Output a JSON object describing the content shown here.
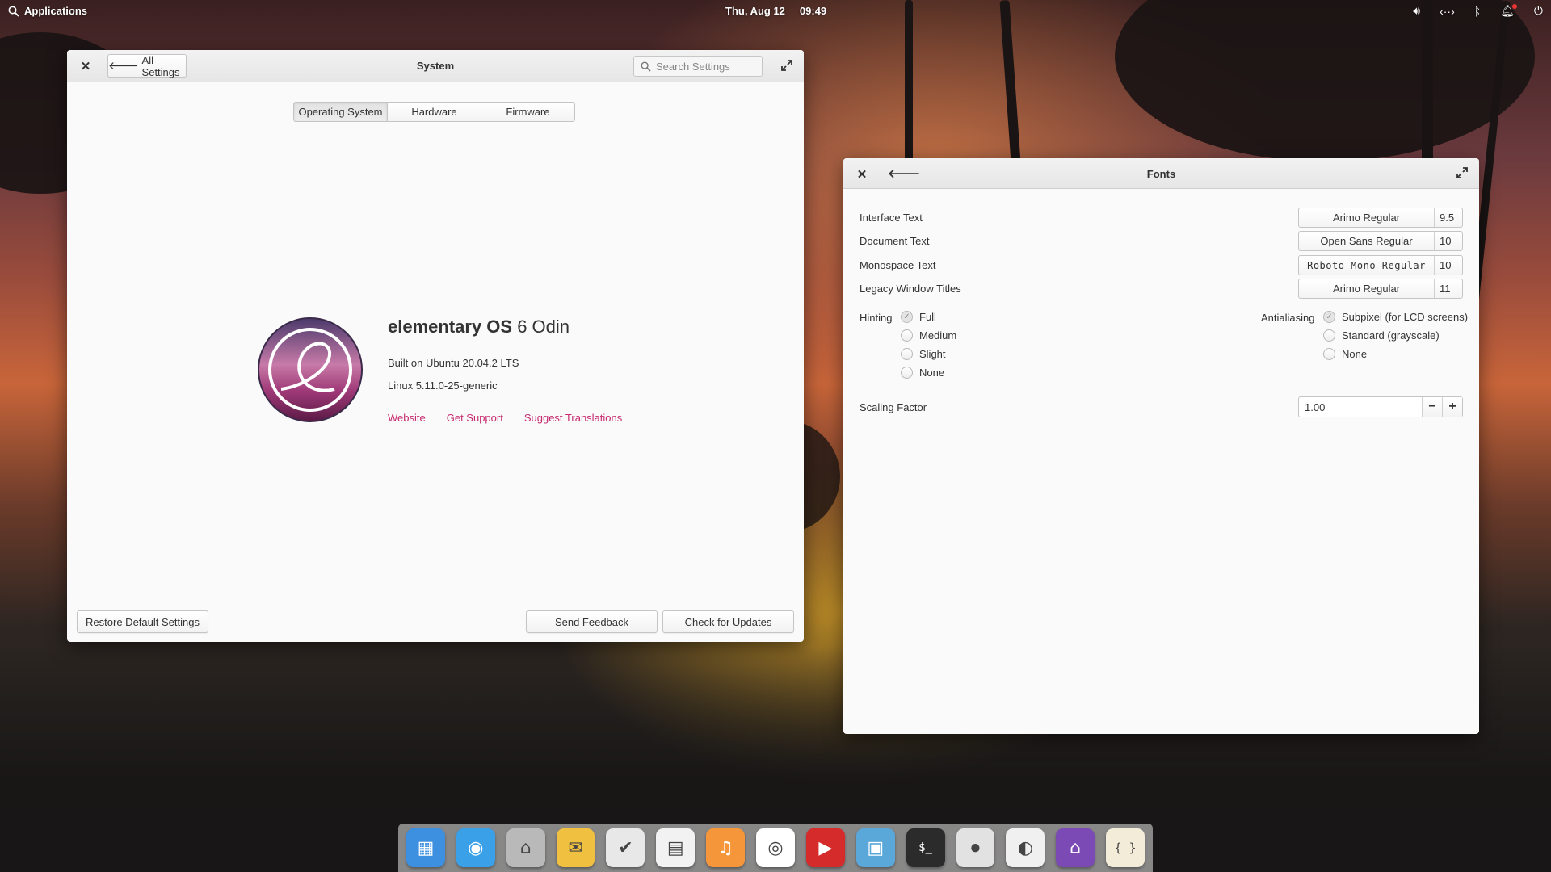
{
  "top_panel": {
    "applications_label": "Applications",
    "date": "Thu, Aug 12",
    "time": "09:49",
    "indicators": [
      "volume-icon",
      "network-icon",
      "bluetooth-icon",
      "notifications-icon",
      "power-icon"
    ]
  },
  "system_window": {
    "title": "System",
    "back_label": "All Settings",
    "search_placeholder": "Search Settings",
    "tabs": [
      "Operating System",
      "Hardware",
      "Firmware"
    ],
    "active_tab": "Operating System",
    "os_name": "elementary OS",
    "os_version": "6 Odin",
    "built_on": "Built on Ubuntu 20.04.2 LTS",
    "kernel": "Linux 5.11.0-25-generic",
    "links": [
      "Website",
      "Get Support",
      "Suggest Translations"
    ],
    "restore_label": "Restore Default Settings",
    "feedback_label": "Send Feedback",
    "updates_label": "Check for Updates"
  },
  "fonts_window": {
    "title": "Fonts",
    "rows": [
      {
        "label": "Interface Text",
        "font": "Arimo Regular",
        "size": "9.5"
      },
      {
        "label": "Document Text",
        "font": "Open Sans Regular",
        "size": "10"
      },
      {
        "label": "Monospace Text",
        "font": "Roboto Mono Regular",
        "size": "10"
      },
      {
        "label": "Legacy Window Titles",
        "font": "Arimo Regular",
        "size": "11"
      }
    ],
    "hinting_label": "Hinting",
    "hinting_options": [
      "Full",
      "Medium",
      "Slight",
      "None"
    ],
    "hinting_selected": "Full",
    "antialiasing_label": "Antialiasing",
    "antialiasing_options": [
      "Subpixel (for LCD screens)",
      "Standard (grayscale)",
      "None"
    ],
    "antialiasing_selected": "Subpixel (for LCD screens)",
    "scaling_label": "Scaling Factor",
    "scaling_value": "1.00",
    "minus": "−",
    "plus": "+"
  },
  "dock": {
    "apps": [
      {
        "name": "multitasking-view-icon",
        "color": "#3d8fe0",
        "glyph": "▦"
      },
      {
        "name": "web-browser-icon",
        "color": "#3aa0e8",
        "glyph": "◉"
      },
      {
        "name": "files-icon",
        "color": "#b9b9b9",
        "glyph": "⌂"
      },
      {
        "name": "mail-icon",
        "color": "#f0c040",
        "glyph": "✉"
      },
      {
        "name": "tasks-icon",
        "color": "#e8e8e8",
        "glyph": "✔"
      },
      {
        "name": "calendar-icon",
        "color": "#f2f2f2",
        "glyph": "▤"
      },
      {
        "name": "music-icon",
        "color": "#f5963a",
        "glyph": "♫"
      },
      {
        "name": "chrome-icon",
        "color": "#ffffff",
        "glyph": "◎"
      },
      {
        "name": "videos-icon",
        "color": "#d52b2b",
        "glyph": "▶"
      },
      {
        "name": "photos-icon",
        "color": "#5aa7d9",
        "glyph": "▣"
      },
      {
        "name": "terminal-icon",
        "color": "#2b2b2b",
        "glyph": "$_"
      },
      {
        "name": "system-settings-icon",
        "color": "#e2e2e2",
        "glyph": "⏺"
      },
      {
        "name": "tweaks-icon",
        "color": "#f0f0f0",
        "glyph": "◐"
      },
      {
        "name": "appcenter-icon",
        "color": "#7b4ab5",
        "glyph": "⌂"
      },
      {
        "name": "code-icon",
        "color": "#f3ecd9",
        "glyph": "{ }"
      }
    ]
  }
}
